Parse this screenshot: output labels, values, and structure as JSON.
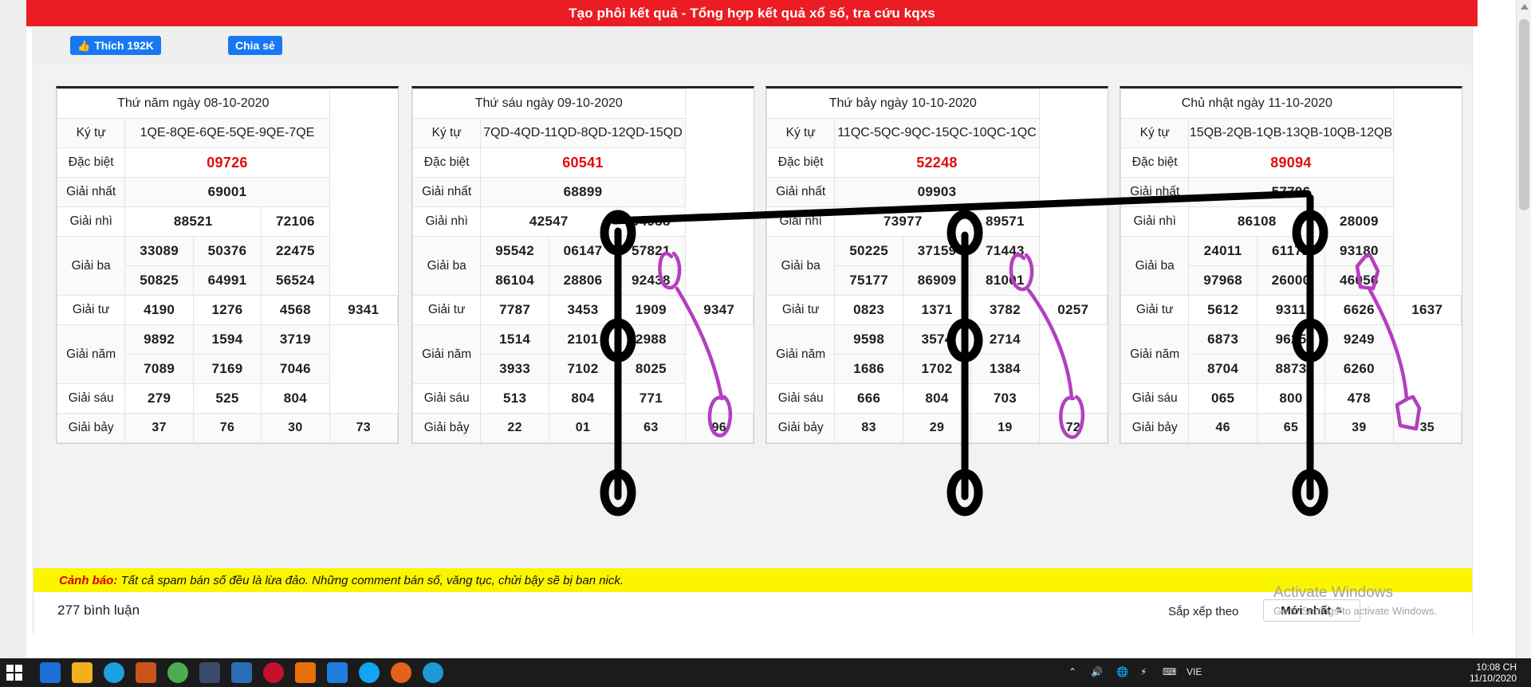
{
  "window": {
    "title": "Tạo phôi kết quả - Tổng hợp kết quả xổ số, tra cứu kqxs"
  },
  "social": {
    "like_label": "Thích 192K",
    "like_icon": "thumbs-up-icon",
    "share_label": "Chia sẻ"
  },
  "labels": {
    "kytu": "Ký tự",
    "dacbiet": "Đặc biệt",
    "nhat": "Giải nhất",
    "nhi": "Giải nhì",
    "ba": "Giải ba",
    "tu": "Giải tư",
    "nam": "Giải năm",
    "sau": "Giải sáu",
    "bay": "Giải bảy"
  },
  "boards": [
    {
      "caption": "Thứ năm ngày 08-10-2020",
      "kytu": "1QE-8QE-6QE-5QE-9QE-7QE",
      "dacbiet": "09726",
      "nhat": "69001",
      "nhi": [
        "88521",
        "72106"
      ],
      "ba": [
        [
          "33089",
          "50376",
          "22475"
        ],
        [
          "50825",
          "64991",
          "56524"
        ]
      ],
      "tu": [
        "4190",
        "1276",
        "4568",
        "9341"
      ],
      "nam": [
        [
          "9892",
          "1594",
          "3719"
        ],
        [
          "7089",
          "7169",
          "7046"
        ]
      ],
      "sau": [
        "279",
        "525",
        "804"
      ],
      "bay": [
        "37",
        "76",
        "30",
        "73"
      ]
    },
    {
      "caption": "Thứ sáu ngày 09-10-2020",
      "kytu": "7QD-4QD-11QD-8QD-12QD-15QD",
      "dacbiet": "60541",
      "nhat": "68899",
      "nhi": [
        "42547",
        "04938"
      ],
      "ba": [
        [
          "95542",
          "06147",
          "57821"
        ],
        [
          "86104",
          "28806",
          "92438"
        ]
      ],
      "tu": [
        "7787",
        "3453",
        "1909",
        "9347"
      ],
      "nam": [
        [
          "1514",
          "2101",
          "2988"
        ],
        [
          "3933",
          "7102",
          "8025"
        ]
      ],
      "sau": [
        "513",
        "804",
        "771"
      ],
      "bay": [
        "22",
        "01",
        "63",
        "96"
      ]
    },
    {
      "caption": "Thứ bảy ngày 10-10-2020",
      "kytu": "11QC-5QC-9QC-15QC-10QC-1QC",
      "dacbiet": "52248",
      "nhat": "09903",
      "nhi": [
        "73977",
        "89571"
      ],
      "ba": [
        [
          "50225",
          "37159",
          "71443"
        ],
        [
          "75177",
          "86909",
          "81001"
        ]
      ],
      "tu": [
        "0823",
        "1371",
        "3782",
        "0257"
      ],
      "nam": [
        [
          "9598",
          "3574",
          "2714"
        ],
        [
          "1686",
          "1702",
          "1384"
        ]
      ],
      "sau": [
        "666",
        "804",
        "703"
      ],
      "bay": [
        "83",
        "29",
        "19",
        "72"
      ]
    },
    {
      "caption": "Chủ nhật ngày 11-10-2020",
      "kytu": "15QB-2QB-1QB-13QB-10QB-12QB",
      "dacbiet": "89094",
      "nhat": "57796",
      "nhi": [
        "86108",
        "28009"
      ],
      "ba": [
        [
          "24011",
          "61172",
          "93180"
        ],
        [
          "97968",
          "26000",
          "46056"
        ]
      ],
      "tu": [
        "5612",
        "9311",
        "6626",
        "1637"
      ],
      "nam": [
        [
          "6873",
          "9625",
          "9249"
        ],
        [
          "8704",
          "8873",
          "6260"
        ]
      ],
      "sau": [
        "065",
        "800",
        "478"
      ],
      "bay": [
        "46",
        "65",
        "39",
        "35"
      ]
    }
  ],
  "warning": {
    "prefix": "Cảnh báo:",
    "text": " Tất cả spam bán số đều là lừa đảo. Những comment bán số, văng tục, chửi bậy sẽ bị ban nick."
  },
  "comments": {
    "count_label": "277 bình luận",
    "sort_label": "Sắp xếp theo",
    "sort_value": "Mới nhất",
    "sort_caret": "⇅"
  },
  "activate": {
    "line1": "Activate Windows",
    "line2": "Go to Settings to activate Windows."
  },
  "taskbar": {
    "start_icon": "windows-start-icon",
    "icons": [
      "mail-icon",
      "file-explorer-icon",
      "edge-icon",
      "store-icon",
      "chrome-icon",
      "news-icon",
      "unikey-icon",
      "coccoc-icon",
      "vlc-icon",
      "zalo-icon",
      "skype-icon",
      "firefox-icon",
      "edge-active-icon"
    ],
    "tray": [
      "chevron-up-icon",
      "volume-icon",
      "network-icon",
      "battery-icon",
      "keyboard-icon"
    ],
    "language": "VIE",
    "time": "10:08 CH",
    "date": "11/10/2020"
  },
  "colors": {
    "title_bar": "#eb1c24",
    "facebook_blue": "#1877f2",
    "special_red": "#e00d0d",
    "warning_yellow": "#fbf500",
    "annotation_black": "#000000",
    "annotation_magenta": "#b43fc0"
  }
}
